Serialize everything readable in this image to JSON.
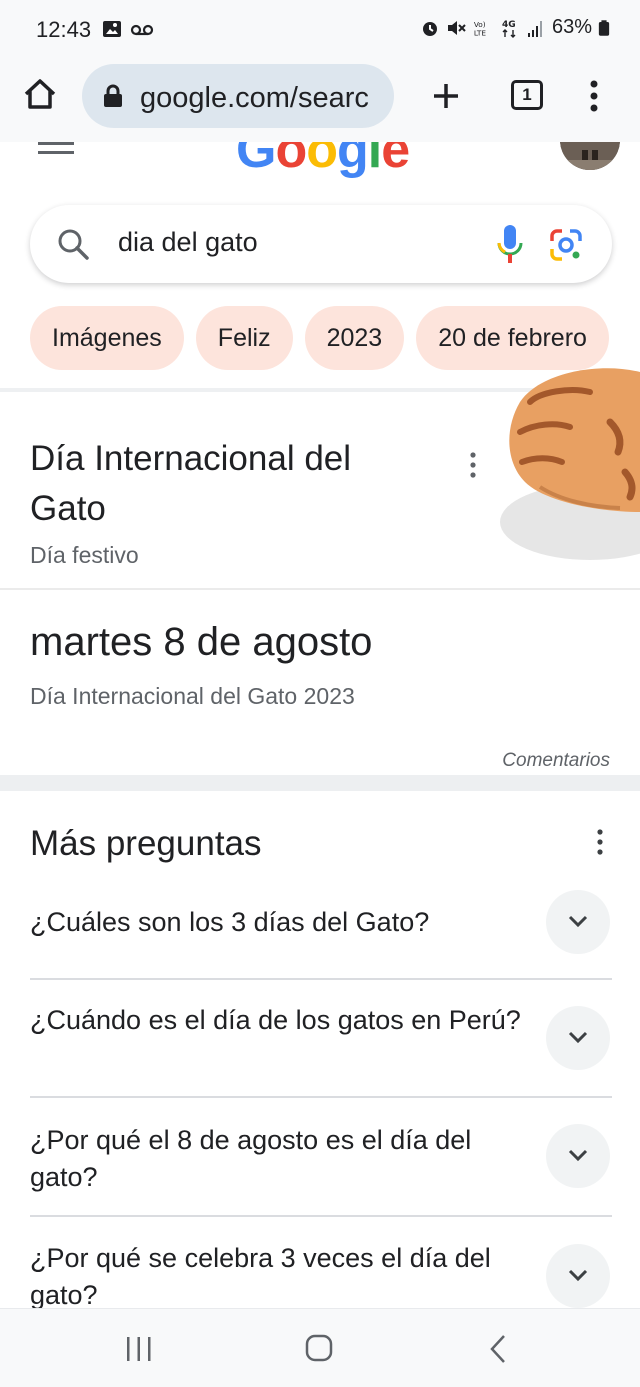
{
  "status_bar": {
    "time": "12:43",
    "battery": "63%"
  },
  "browser": {
    "url": "google.com/searc",
    "tab_count": "1"
  },
  "search": {
    "query": "dia del gato"
  },
  "chips": [
    "Imágenes",
    "Feliz",
    "2023",
    "20 de febrero"
  ],
  "knowledge_panel": {
    "title": "Día Internacional del Gato",
    "subtitle": "Día festivo",
    "date": "martes 8 de agosto",
    "date_caption": "Día Internacional del Gato 2023",
    "feedback": "Comentarios"
  },
  "more_questions": {
    "title": "Más preguntas",
    "items": [
      "¿Cuáles son los 3 días del Gato?",
      "¿Cuándo es el día de los gatos en Perú?",
      "¿Por qué el 8 de agosto es el día del gato?",
      "¿Por qué se celebra 3 veces el día del gato?"
    ]
  },
  "colors": {
    "chip_bg": "#fde4dc",
    "url_pill_bg": "#dde6ee",
    "google_blue": "#4285f4",
    "google_red": "#ea4335",
    "google_yellow": "#fbbc05",
    "google_green": "#34a853"
  },
  "icons": {
    "home": "home-icon",
    "lock": "lock-icon",
    "new_tab": "plus-icon",
    "tabs": "tab-switcher-icon",
    "menu": "more-vert-icon",
    "search": "search-icon",
    "voice": "mic-icon",
    "lens": "google-lens-icon",
    "expand": "chevron-down-icon"
  }
}
